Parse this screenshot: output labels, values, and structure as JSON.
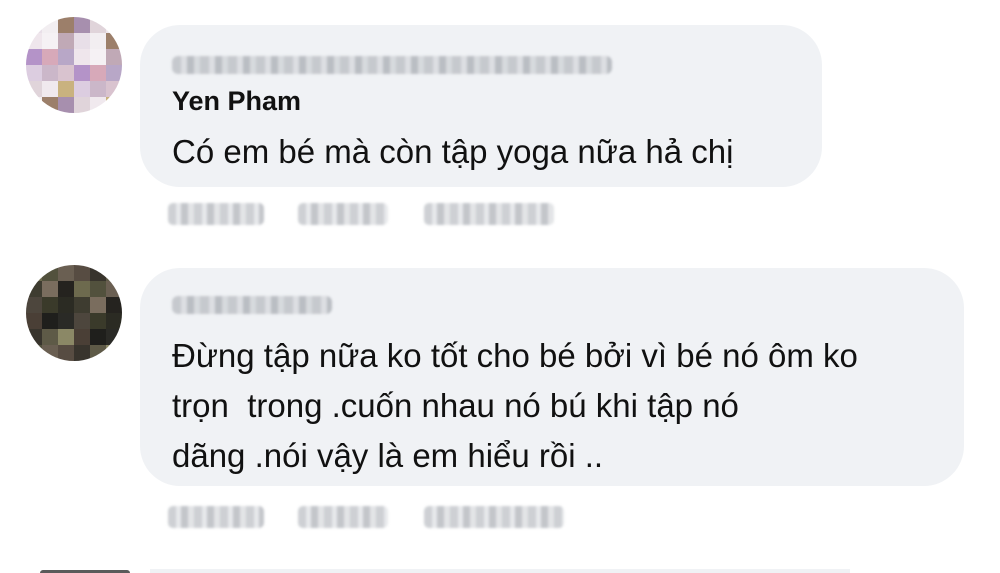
{
  "comments": [
    {
      "author": "Yen Pham",
      "text": "Có em bé mà còn tập yoga nữa hả chị",
      "avatar_colors": [
        "#e8dfe8",
        "#d7a9b9",
        "#c9b27f",
        "#f2eef1",
        "#b8a7c7",
        "#dccde0",
        "#9c7f6a",
        "#efe6ec",
        "#cbb7c9",
        "#a78fae",
        "#f5f1f4",
        "#d9c3cf",
        "#e0d4da",
        "#c0a9b6",
        "#b493c8",
        "#f0e9ee"
      ]
    },
    {
      "author": "",
      "text_lines": [
        "Đừng tập nữa ko tốt cho bé bởi vì bé nó ôm ko",
        "trọn  trong .cuốn nhau nó bú khi tập nó",
        "dãng .nói vậy là em hiểu rồi .."
      ],
      "avatar_colors": [
        "#6d6a4e",
        "#3a3a2a",
        "#8b8866",
        "#52513d",
        "#2b2b23",
        "#4a3f36",
        "#6a5f52",
        "#3e3c30",
        "#1f1f1c",
        "#574c42",
        "#7a6d5e",
        "#2a2a26",
        "#38342d",
        "#25231f",
        "#4d463d",
        "#5e5a47"
      ]
    }
  ]
}
